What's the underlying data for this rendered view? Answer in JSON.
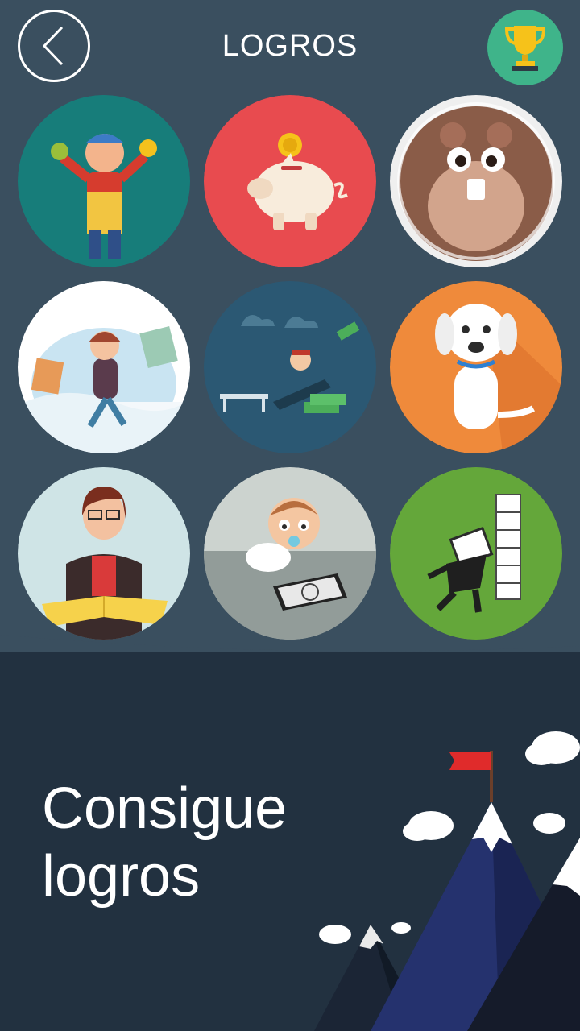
{
  "header": {
    "title": "LOGROS",
    "back_icon": "chevron-left-icon",
    "trophy_icon": "trophy-icon"
  },
  "achievements": [
    {
      "name": "farmer-badge",
      "bg": "#177d7a"
    },
    {
      "name": "piggy-bank-badge",
      "bg": "#e84b4f"
    },
    {
      "name": "hamster-badge",
      "bg": "#efefef"
    },
    {
      "name": "shopping-girl-badge",
      "bg": "#ffffff"
    },
    {
      "name": "relaxing-money-badge",
      "bg": "#2b5873"
    },
    {
      "name": "dog-badge",
      "bg": "#ef8a3b"
    },
    {
      "name": "reading-woman-badge",
      "bg": "#cfe4e6"
    },
    {
      "name": "baby-tablet-badge",
      "bg": "#ccd3cf"
    },
    {
      "name": "wall-crash-badge",
      "bg": "#64a73a"
    }
  ],
  "promo": {
    "line1": "Consigue",
    "line2": "logros"
  },
  "colors": {
    "panel": "#3a4f5f",
    "bottom": "#223140",
    "trophy_bg": "#3fb48a",
    "flag": "#e02b2b"
  }
}
